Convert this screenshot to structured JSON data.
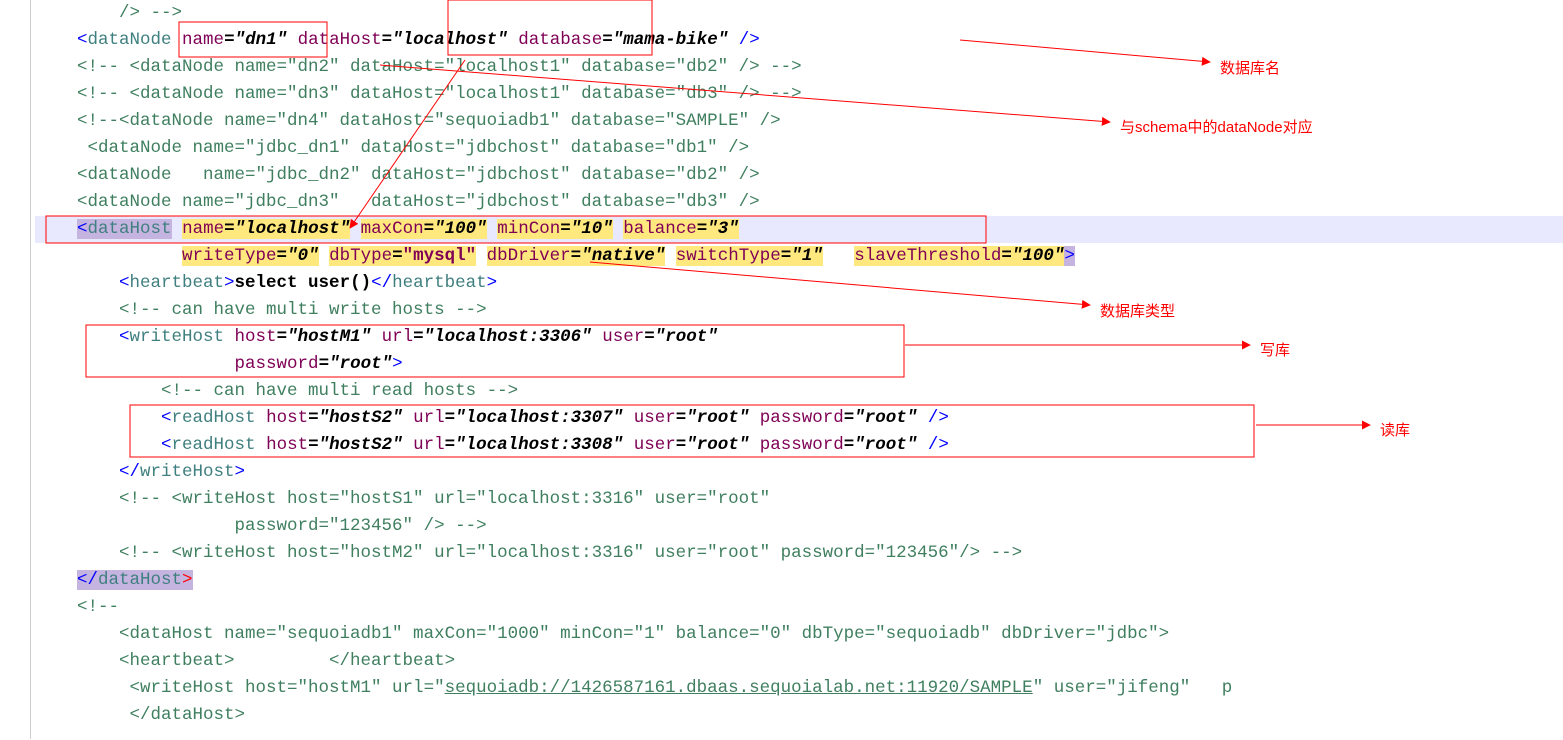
{
  "code": {
    "l0": "        /> -->",
    "l1a": "    <",
    "l1b": "dataNode",
    "l1c": " ",
    "l1d": "name",
    "l1e": "=",
    "l1f": "\"dn1\"",
    "l1g": " ",
    "l1h": "dataHost",
    "l1i": "=",
    "l1j": "\"localhost\"",
    "l1k": " ",
    "l1l": "database",
    "l1m": "=",
    "l1n": "\"mama-bike\"",
    "l1o": " />",
    "l2": "    <!-- <dataNode name=\"dn2\" dataHost=\"localhost1\" database=\"db2\" /> -->",
    "l3": "    <!-- <dataNode name=\"dn3\" dataHost=\"localhost1\" database=\"db3\" /> -->",
    "l4": "    <!--<dataNode name=\"dn4\" dataHost=\"sequoiadb1\" database=\"SAMPLE\" />",
    "l5": "     <dataNode name=\"jdbc_dn1\" dataHost=\"jdbchost\" database=\"db1\" />",
    "l6": "    <dataNode   name=\"jdbc_dn2\" dataHost=\"jdbchost\" database=\"db2\" />",
    "l7": "    <dataNode name=\"jdbc_dn3\"   dataHost=\"jdbchost\" database=\"db3\" />",
    "l8a": "    ",
    "l8b": "<",
    "l8c": "dataHost",
    "l8d": " ",
    "l8e": "name",
    "l8f": "=",
    "l8g": "\"localhost\"",
    "l8h": " ",
    "l8i": "maxCon",
    "l8j": "=",
    "l8k": "\"100\"",
    "l8l": " ",
    "l8m": "minCon",
    "l8n": "=",
    "l8o": "\"10\"",
    "l8p": " ",
    "l8q": "balance",
    "l8r": "=",
    "l8s": "\"3\"",
    "l9a": "              ",
    "l9b": "writeType",
    "l9c": "=",
    "l9d": "\"0\"",
    "l9e": " ",
    "l9f": "dbType",
    "l9g": "=",
    "l9h": "\"mysql\"",
    "l9i": " ",
    "l9j": "dbDriver",
    "l9k": "=",
    "l9l": "\"native\"",
    "l9m": " ",
    "l9n": "switchType",
    "l9o": "=",
    "l9p": "\"1\"",
    "l9q": "   ",
    "l9r": "slaveThreshold",
    "l9s": "=",
    "l9t": "\"100\"",
    "l9u": ">",
    "l10a": "        <",
    "l10b": "heartbeat",
    "l10c": ">",
    "l10d": "select user()",
    "l10e": "</",
    "l10f": "heartbeat",
    "l10g": ">",
    "l11": "        <!-- can have multi write hosts -->",
    "l12a": "        <",
    "l12b": "writeHost",
    "l12c": " ",
    "l12d": "host",
    "l12e": "=",
    "l12f": "\"hostM1\"",
    "l12g": " ",
    "l12h": "url",
    "l12i": "=",
    "l12j": "\"localhost:3306\"",
    "l12k": " ",
    "l12l": "user",
    "l12m": "=",
    "l12n": "\"root\"",
    "l13a": "                   ",
    "l13b": "password",
    "l13c": "=",
    "l13d": "\"root\"",
    "l13e": ">",
    "l14": "            <!-- can have multi read hosts -->",
    "l15a": "            <",
    "l15b": "readHost",
    "l15c": " ",
    "l15d": "host",
    "l15e": "=",
    "l15f": "\"hostS2\"",
    "l15g": " ",
    "l15h": "url",
    "l15i": "=",
    "l15j": "\"localhost:3307\"",
    "l15k": " ",
    "l15l": "user",
    "l15m": "=",
    "l15n": "\"root\"",
    "l15o": " ",
    "l15p": "password",
    "l15q": "=",
    "l15r": "\"root\"",
    "l15s": " />",
    "l16a": "            <",
    "l16b": "readHost",
    "l16c": " ",
    "l16d": "host",
    "l16e": "=",
    "l16f": "\"hostS2\"",
    "l16g": " ",
    "l16h": "url",
    "l16i": "=",
    "l16j": "\"localhost:3308\"",
    "l16k": " ",
    "l16l": "user",
    "l16m": "=",
    "l16n": "\"root\"",
    "l16o": " ",
    "l16p": "password",
    "l16q": "=",
    "l16r": "\"root\"",
    "l16s": " />",
    "l17a": "        </",
    "l17b": "writeHost",
    "l17c": ">",
    "l18": "        <!-- <writeHost host=\"hostS1\" url=\"localhost:3316\" user=\"root\"",
    "l19": "                   password=\"123456\" /> -->",
    "l20": "        <!-- <writeHost host=\"hostM2\" url=\"localhost:3316\" user=\"root\" password=\"123456\"/> -->",
    "l21a": "    ",
    "l21b": "</",
    "l21c": "dataHost",
    "l21d": ">",
    "l22": "    <!--",
    "l23": "        <dataHost name=\"sequoiadb1\" maxCon=\"1000\" minCon=\"1\" balance=\"0\" dbType=\"sequoiadb\" dbDriver=\"jdbc\">",
    "l24": "        <heartbeat>         </heartbeat>",
    "l25a": "         <writeHost host=\"hostM1\" url=\"",
    "l25b": "sequoiadb://1426587161.dbaas.sequoialab.net:11920/SAMPLE",
    "l25c": "\" user=\"jifeng\"   p",
    "l26": "         </dataHost>"
  },
  "labels": {
    "db_name": "数据库名",
    "datanode_corr": "与schema中的dataNode对应",
    "db_type": "数据库类型",
    "write_db": "写库",
    "read_db": "读库"
  }
}
